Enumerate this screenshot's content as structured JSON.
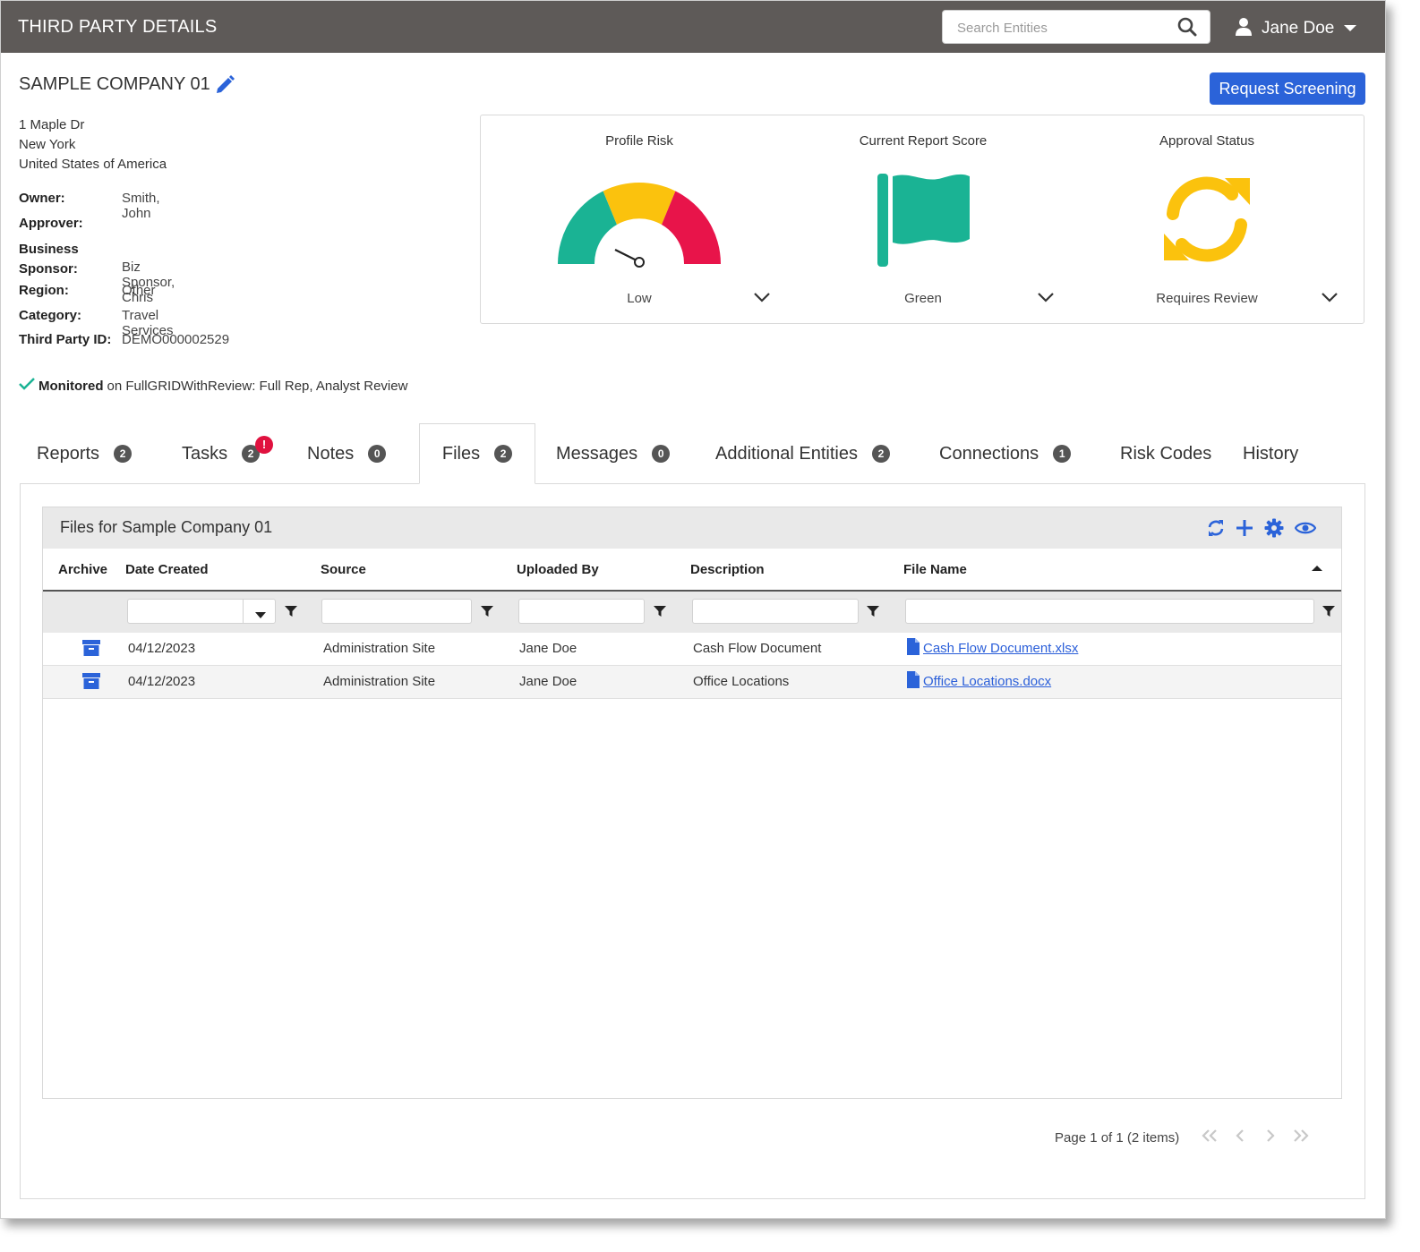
{
  "header": {
    "title": "THIRD PARTY DETAILS",
    "search_placeholder": "Search Entities",
    "user_name": "Jane Doe"
  },
  "company": {
    "name": "SAMPLE COMPANY 01",
    "request_button": "Request Screening",
    "address": [
      "1 Maple Dr",
      "New York",
      "United States of America"
    ],
    "details": [
      {
        "label": "Owner:",
        "value": "Smith, John"
      },
      {
        "label": "Approver:",
        "value": ""
      },
      {
        "label": "Business Sponsor:",
        "value": "Biz Sponsor, Chris"
      },
      {
        "label": "Region:",
        "value": "Other"
      },
      {
        "label": "Category:",
        "value": "Travel Services"
      },
      {
        "label": "Third Party ID:",
        "value": "DEMO000002529"
      }
    ],
    "monitored_label": "Monitored",
    "monitored_text": "on FullGRIDWithReview: Full Rep, Analyst Review"
  },
  "scores": [
    {
      "title": "Profile Risk",
      "value": "Low",
      "icon": "risk-gauge-icon"
    },
    {
      "title": "Current Report Score",
      "value": "Green",
      "icon": "flag-icon"
    },
    {
      "title": "Approval Status",
      "value": "Requires Review",
      "icon": "refresh-icon"
    }
  ],
  "colors": {
    "topbar": "#5e5a58",
    "accent": "#2b63d9",
    "gauge_green": "#1ab394",
    "gauge_yellow": "#fbc20d",
    "gauge_red": "#e8144a",
    "flag_green": "#1ab394",
    "status_yellow": "#fbc20d",
    "alert_red": "#e0113f"
  },
  "tabs": [
    {
      "label": "Reports",
      "count": "2"
    },
    {
      "label": "Tasks",
      "count": "2",
      "alert": "!"
    },
    {
      "label": "Notes",
      "count": "0"
    },
    {
      "label": "Files",
      "count": "2",
      "active": true
    },
    {
      "label": "Messages",
      "count": "0"
    },
    {
      "label": "Additional Entities",
      "count": "2"
    },
    {
      "label": "Connections",
      "count": "1"
    },
    {
      "label": "Risk Codes"
    },
    {
      "label": "History"
    }
  ],
  "files_grid": {
    "title": "Files for Sample Company 01",
    "columns": [
      "Archive",
      "Date Created",
      "Source",
      "Uploaded By",
      "Description",
      "File Name"
    ],
    "rows": [
      {
        "date": "04/12/2023",
        "source": "Administration Site",
        "uploaded_by": "Jane Doe",
        "description": "Cash Flow Document",
        "file_name": "Cash Flow Document.xlsx"
      },
      {
        "date": "04/12/2023",
        "source": "Administration Site",
        "uploaded_by": "Jane Doe",
        "description": "Office Locations",
        "file_name": "Office Locations.docx"
      }
    ],
    "pager_text": "Page 1 of 1 (2 items)"
  }
}
